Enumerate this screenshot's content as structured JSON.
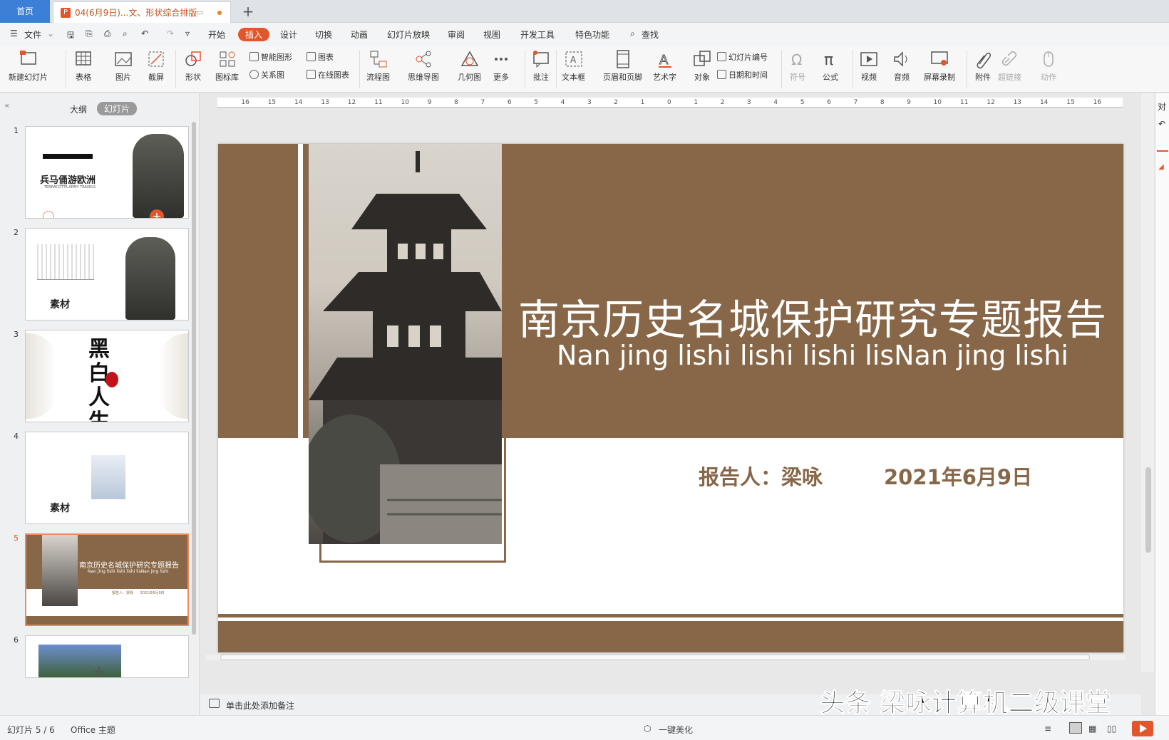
{
  "titlebar": {
    "home_tab": "首页",
    "doc_tab": "04(6月9日)...文、形状综合排版",
    "add_tab": "+"
  },
  "menubar": {
    "file": "文件",
    "items": [
      "开始",
      "插入",
      "设计",
      "切换",
      "动画",
      "幻灯片放映",
      "审阅",
      "视图",
      "开发工具",
      "特色功能"
    ],
    "active": "插入",
    "search": "查找"
  },
  "ribbon": {
    "new_slide": "新建幻灯片",
    "table": "表格",
    "picture": "图片",
    "screenshot": "截屏",
    "shape": "形状",
    "icon_lib": "图标库",
    "smart_shape": "智能图形",
    "chart": "图表",
    "relation": "关系图",
    "online_chart": "在线图表",
    "flowchart": "流程图",
    "mindmap": "思维导图",
    "geometry": "几何图",
    "more": "更多",
    "comment": "批注",
    "textbox": "文本框",
    "header_footer": "页眉和页脚",
    "wordart": "艺术字",
    "object": "对象",
    "slide_number": "幻灯片编号",
    "date_time": "日期和时间",
    "symbol": "符号",
    "formula": "公式",
    "video": "视频",
    "audio": "音频",
    "screen_record": "屏幕录制",
    "attachment": "附件",
    "hyperlink": "超链接",
    "action": "动作"
  },
  "leftpanel": {
    "outline_tab": "大纲",
    "slides_tab": "幻灯片",
    "thumbs": [
      {
        "num": "1",
        "title": "兵马俑游欧洲",
        "sub": "TERRACOTTA ARMY TRAVELS"
      },
      {
        "num": "2",
        "title": "素材"
      },
      {
        "num": "3",
        "title": "黑白人生"
      },
      {
        "num": "4",
        "title": "素材"
      },
      {
        "num": "5",
        "title": "南京历史名城保护研究专题报告",
        "sub": "Nan jing lishi lishi lishi lisNan jing lishi",
        "meta": "报告人：梁咏      2021年6月9日"
      },
      {
        "num": "6"
      }
    ],
    "add": "+"
  },
  "ruler": {
    "ticks": [
      "16",
      "15",
      "14",
      "13",
      "12",
      "11",
      "10",
      "9",
      "8",
      "7",
      "6",
      "5",
      "4",
      "3",
      "2",
      "1",
      "0",
      "1",
      "2",
      "3",
      "4",
      "5",
      "6",
      "7",
      "8",
      "9",
      "10",
      "11",
      "12",
      "13",
      "14",
      "15",
      "16"
    ]
  },
  "slide": {
    "title": "南京历史名城保护研究专题报告",
    "subtitle": "Nan jing lishi lishi lishi lisNan jing lishi",
    "reporter": "报告人：梁咏",
    "date": "2021年6月9日",
    "brand_color": "#876748"
  },
  "notes": {
    "placeholder": "单击此处添加备注"
  },
  "watermark": "头条 梁咏计算机二级课堂",
  "status": {
    "slide_count": "幻灯片 5 / 6",
    "theme": "Office 主题",
    "beautify": "一键美化"
  },
  "rightstrip": {
    "label": "对"
  },
  "colors": {
    "accent": "#e2562b",
    "home_tab": "#3b7fd6"
  }
}
